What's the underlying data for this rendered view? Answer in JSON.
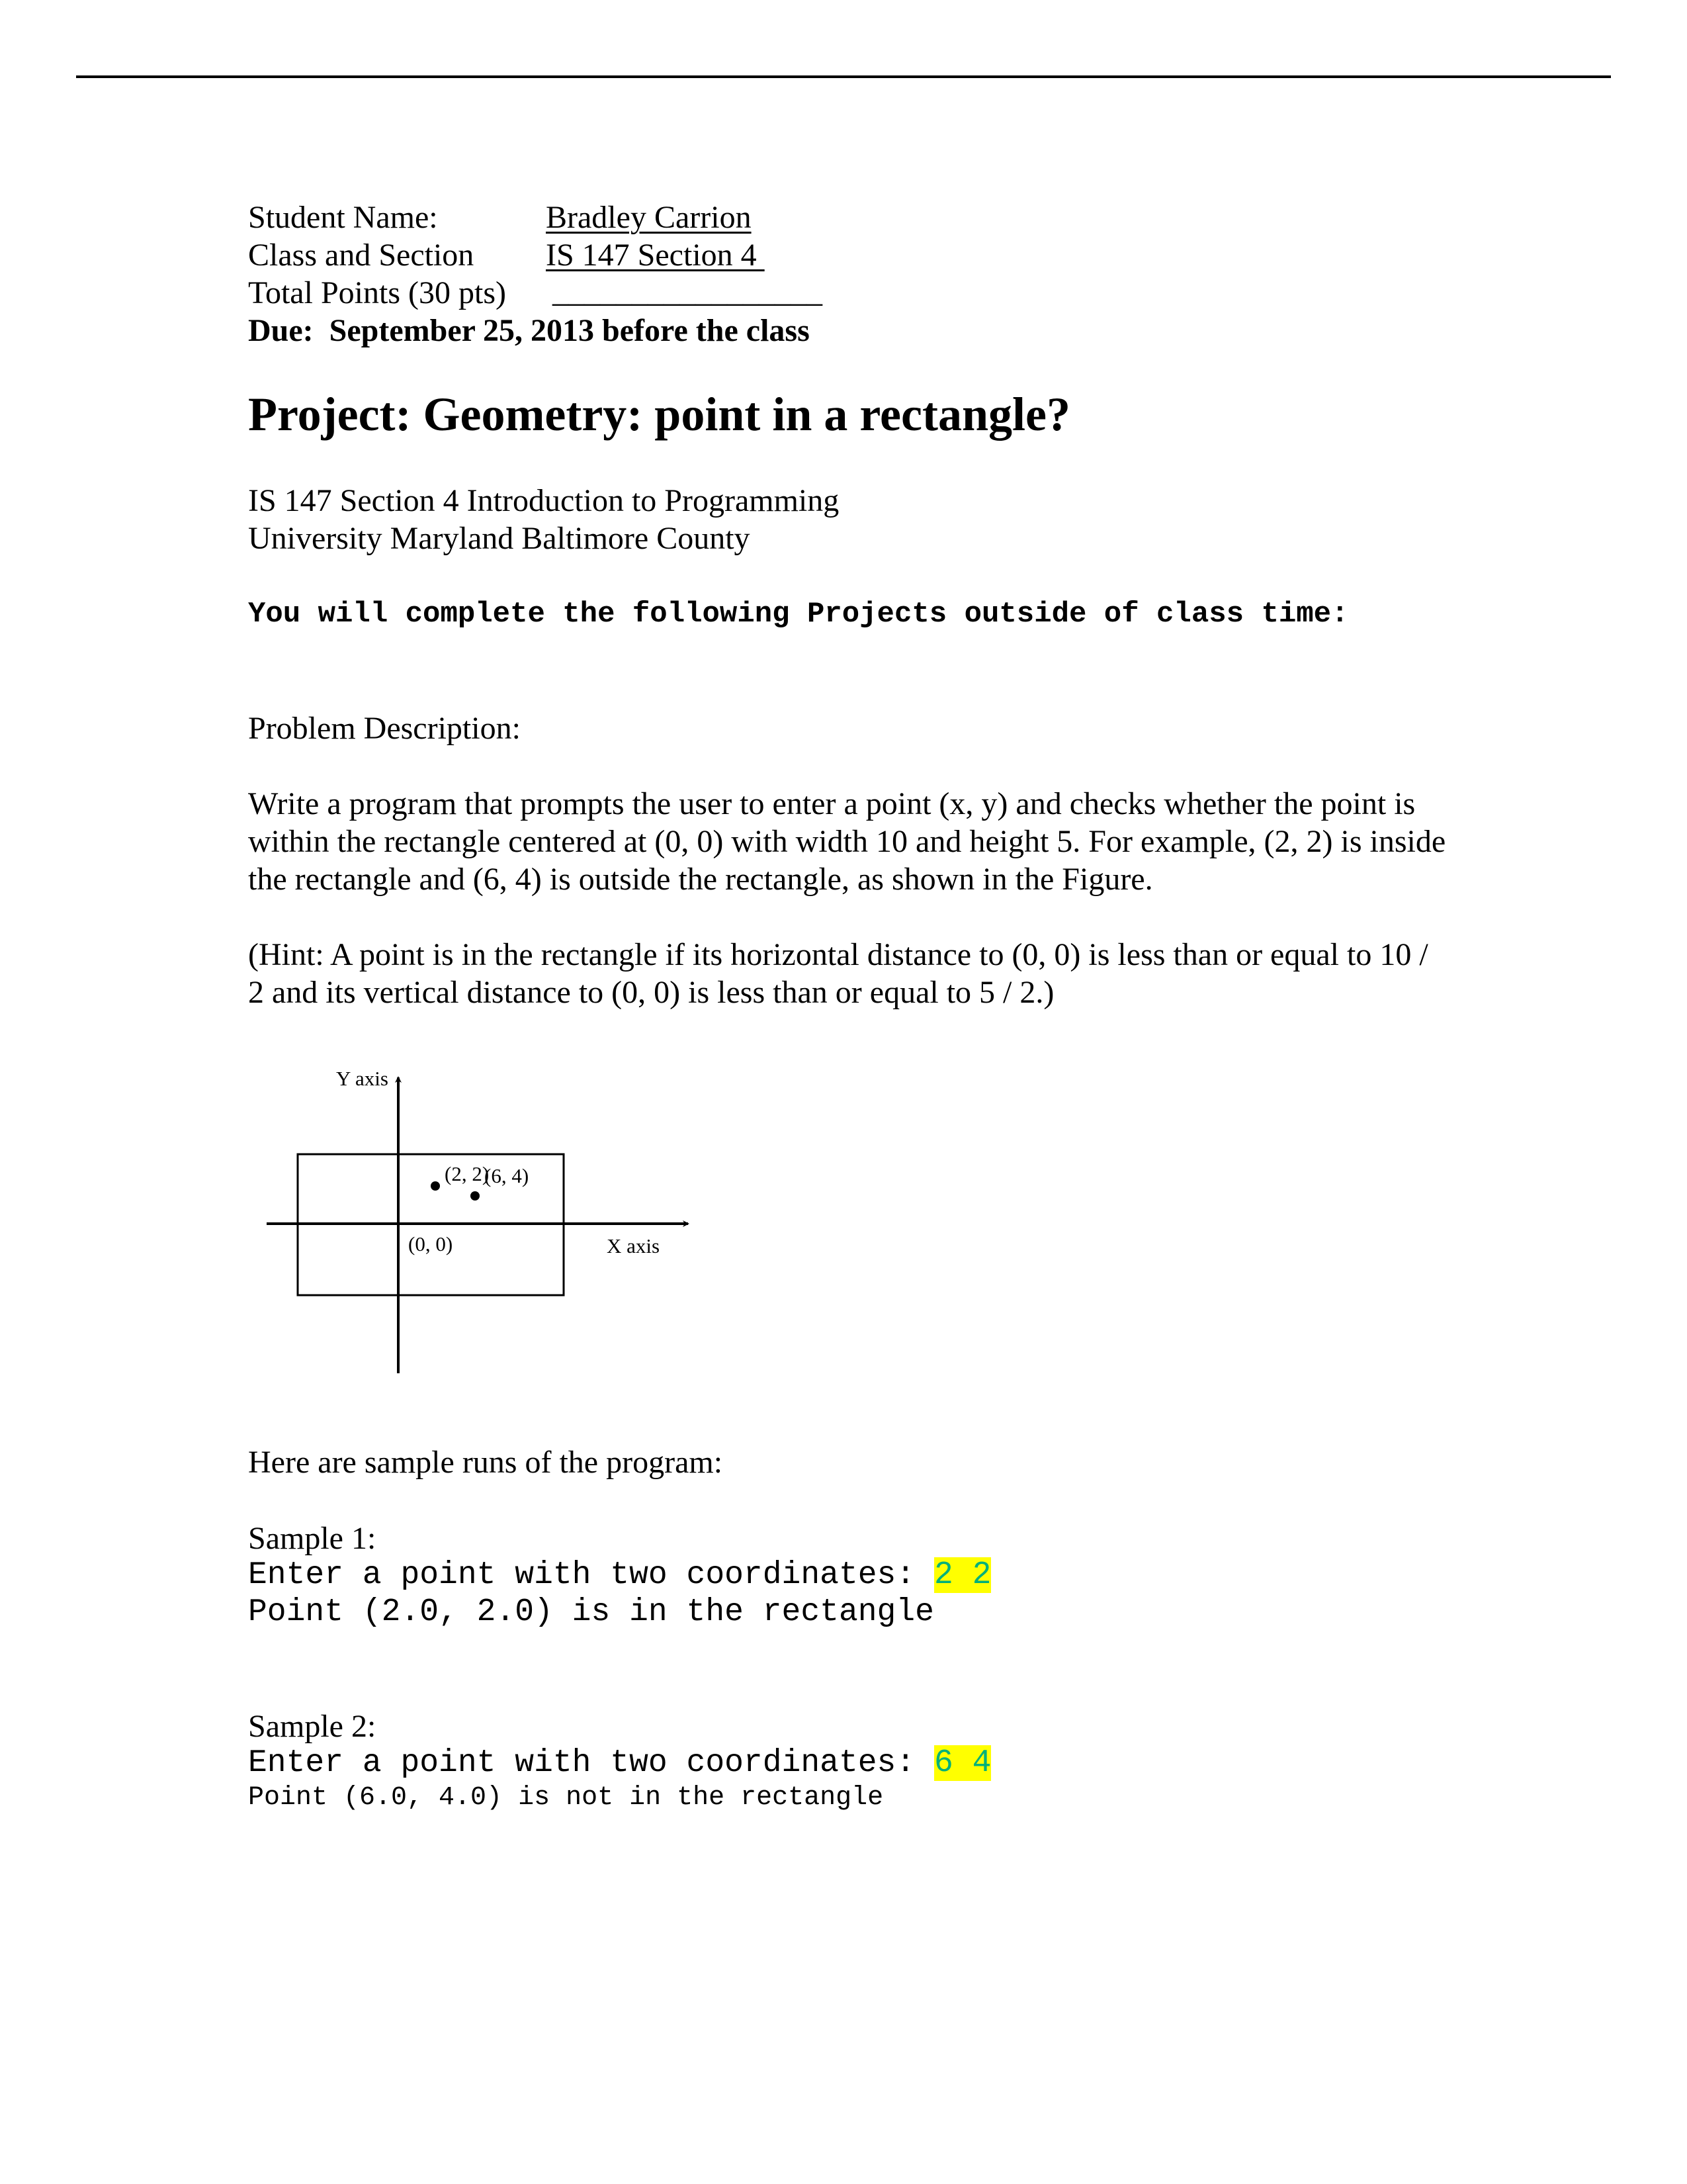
{
  "header": {
    "student_name_label": "Student Name:",
    "student_name_value": "Bradley Carrion",
    "class_section_label": "Class and Section",
    "class_section_value": "IS 147 Section 4 ",
    "total_points_label": "Total Points (30 pts)",
    "total_points_value": "_________________",
    "due": "Due:  September 25, 2013 before the class"
  },
  "title": "Project: Geometry: point in a rectangle?",
  "course": {
    "line1": "IS 147 Section 4 Introduction to Programming",
    "line2": "University Maryland Baltimore County"
  },
  "instructions": "You will complete the following Projects outside of class time:",
  "problem_heading": "Problem Description:",
  "problem_text": "Write a program that prompts the user to enter a point (x, y) and checks whether the point is within the rectangle centered at (0, 0) with width 10 and height 5. For example, (2, 2) is inside the rectangle and (6, 4) is outside the rectangle, as shown in the Figure.",
  "hint_text": "(Hint: A point is in the rectangle if its horizontal distance to (0, 0) is less than or equal to 10 / 2 and its vertical distance to (0, 0) is less than or equal to 5 / 2.)",
  "figure": {
    "y_axis_label": "Y axis",
    "x_axis_label": "X axis",
    "origin_label": "(0, 0)",
    "rectangle": {
      "center": [
        0,
        0
      ],
      "width": 10,
      "height": 5
    },
    "points": [
      {
        "label": "(2, 2)",
        "x": 2,
        "y": 2
      },
      {
        "label": "(6, 4)",
        "x": 6,
        "y": 4
      }
    ]
  },
  "samples_intro": "Here are sample runs of the program:",
  "samples": [
    {
      "label": "Sample 1:",
      "prompt": "Enter a point with two coordinates: ",
      "input": "2 2",
      "output": "Point (2.0, 2.0) is in the rectangle"
    },
    {
      "label": "Sample 2:",
      "prompt": "Enter a point with two coordinates: ",
      "input": "6 4",
      "output": "Point (6.0, 4.0) is not in the rectangle"
    }
  ],
  "colors": {
    "highlight": "#ffff00",
    "input_text": "#00b07a"
  }
}
